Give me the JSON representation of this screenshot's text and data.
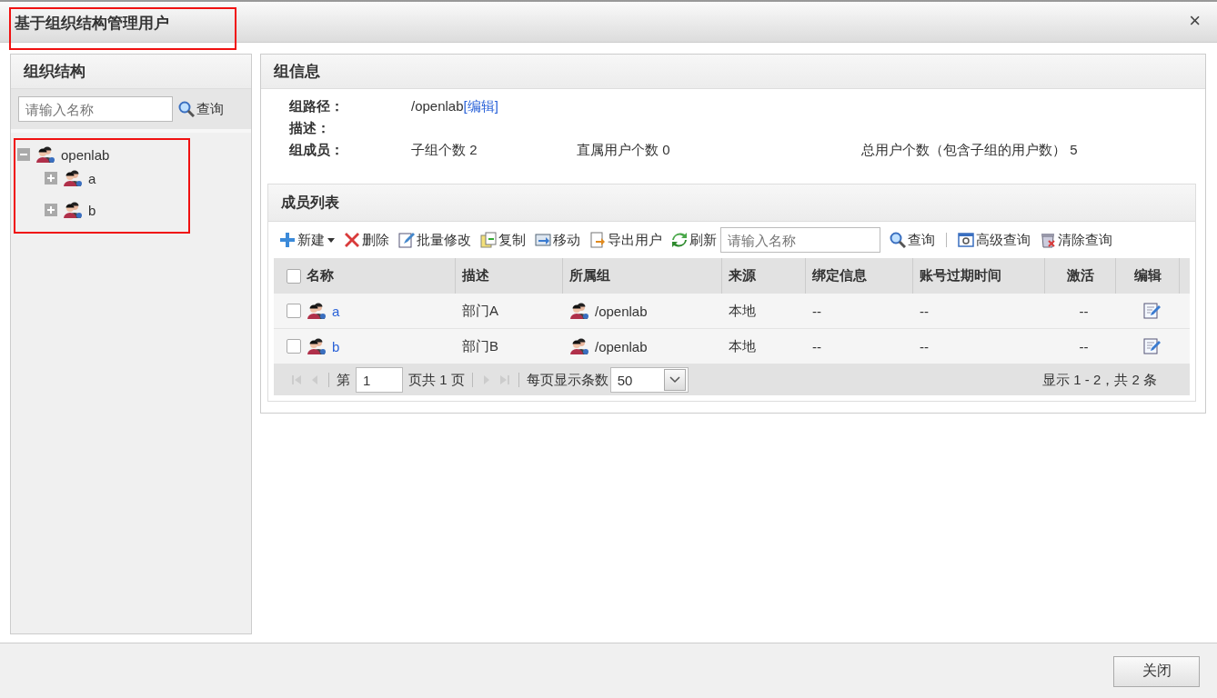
{
  "window": {
    "title": "基于组织结构管理用户",
    "title_highlighted": true,
    "close": "×"
  },
  "org_panel": {
    "title": "组织结构",
    "search": {
      "placeholder": "请输入名称",
      "button": "查询"
    },
    "tree_highlighted": true,
    "tree": [
      {
        "label": "openlab",
        "expanded": true,
        "children": [
          {
            "label": "a",
            "expanded": false
          },
          {
            "label": "b",
            "expanded": false
          }
        ]
      }
    ]
  },
  "group_info": {
    "title": "组信息",
    "fields": [
      {
        "label": "组路径：",
        "values": [
          "/openlab"
        ],
        "link": "[编辑]"
      },
      {
        "label": "描述："
      },
      {
        "label": "组成员：",
        "values": [
          "子组个数 2",
          "直属用户个数 0",
          "总用户个数（包含子组的用户数） 5"
        ]
      }
    ]
  },
  "member_list": {
    "title": "成员列表",
    "toolbar": [
      {
        "kind": "button",
        "label": "新建",
        "dropdown": true
      },
      {
        "kind": "button",
        "label": "删除"
      },
      {
        "kind": "button",
        "label": "批量修改"
      },
      {
        "kind": "button",
        "label": "复制"
      },
      {
        "kind": "button",
        "label": "移动"
      },
      {
        "kind": "button",
        "label": "导出用户"
      },
      {
        "kind": "button",
        "label": "刷新"
      },
      {
        "kind": "search",
        "placeholder": "请输入名称"
      },
      {
        "kind": "button",
        "label": "查询"
      },
      {
        "kind": "separator"
      },
      {
        "kind": "button",
        "label": "高级查询"
      },
      {
        "kind": "button",
        "label": "清除查询"
      }
    ],
    "header_checked": false,
    "columns": [
      "名称",
      "描述",
      "所属组",
      "来源",
      "绑定信息",
      "账号过期时间",
      "激活",
      "编辑"
    ],
    "rows": [
      {
        "checked": false,
        "name": "a",
        "description": "部门A",
        "group": "/openlab",
        "source": "本地",
        "binding": "--",
        "expiry": "--",
        "active": "--"
      },
      {
        "checked": false,
        "name": "b",
        "description": "部门B",
        "group": "/openlab",
        "source": "本地",
        "binding": "--",
        "expiry": "--",
        "active": "--"
      }
    ],
    "pager": {
      "page_prefix": "第",
      "page": "1",
      "page_suffix": "页共 1 页",
      "per_page_label": "每页显示条数",
      "per_page": "50",
      "summary": "显示 1 - 2，共 2 条"
    }
  },
  "footer": {
    "close_button": "关闭"
  }
}
